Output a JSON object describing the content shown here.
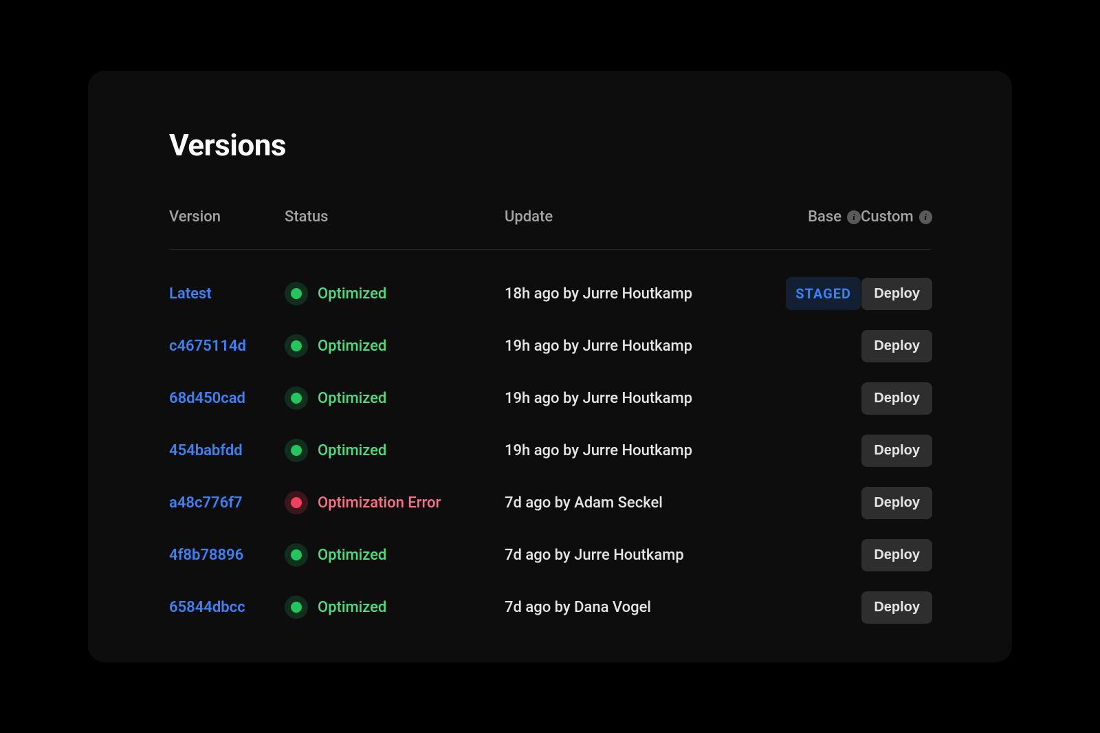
{
  "page": {
    "title": "Versions"
  },
  "columns": {
    "version": "Version",
    "status": "Status",
    "update": "Update",
    "base": "Base",
    "custom": "Custom"
  },
  "labels": {
    "deploy": "Deploy",
    "staged": "STAGED"
  },
  "status_labels": {
    "optimized": "Optimized",
    "error": "Optimization Error"
  },
  "colors": {
    "link": "#3b82f6",
    "success": "#22c55e",
    "error": "#f43f5e",
    "background": "#0d0d0d"
  },
  "versions": [
    {
      "id": "Latest",
      "status": "optimized",
      "update": "18h ago by Jurre Houtkamp",
      "base_staged": true
    },
    {
      "id": "c4675114d",
      "status": "optimized",
      "update": "19h ago by Jurre Houtkamp",
      "base_staged": false
    },
    {
      "id": "68d450cad",
      "status": "optimized",
      "update": "19h ago by Jurre Houtkamp",
      "base_staged": false
    },
    {
      "id": "454babfdd",
      "status": "optimized",
      "update": "19h ago by Jurre Houtkamp",
      "base_staged": false
    },
    {
      "id": "a48c776f7",
      "status": "error",
      "update": "7d ago by Adam Seckel",
      "base_staged": false
    },
    {
      "id": "4f8b78896",
      "status": "optimized",
      "update": "7d ago by Jurre Houtkamp",
      "base_staged": false
    },
    {
      "id": "65844dbcc",
      "status": "optimized",
      "update": "7d ago by Dana Vogel",
      "base_staged": false
    }
  ]
}
